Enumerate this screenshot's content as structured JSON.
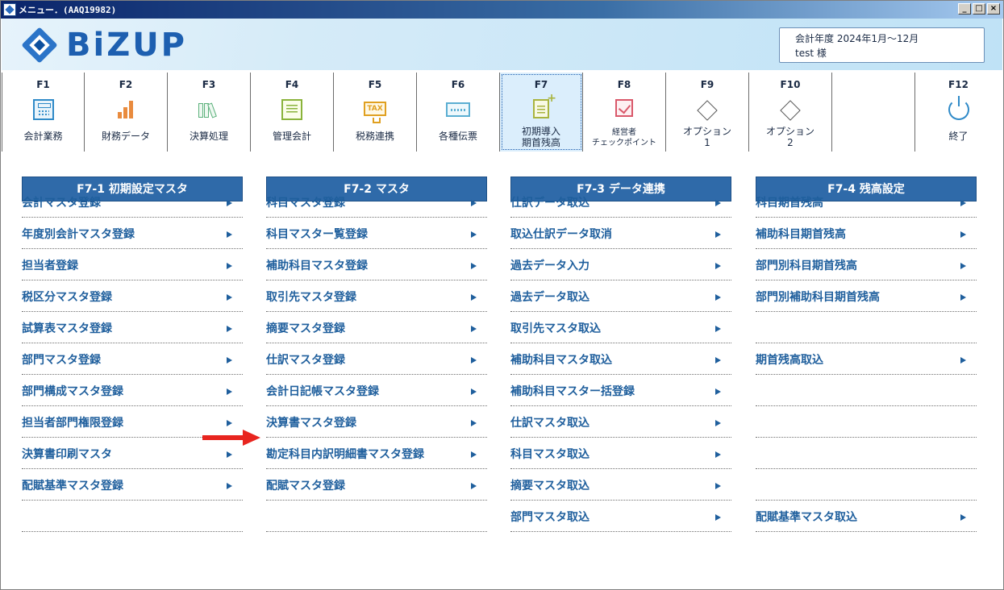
{
  "window": {
    "title": "メニュー．(AAQ19982)",
    "buttons": [
      "_",
      "□",
      "×"
    ]
  },
  "header": {
    "logo_text": "BiZUP",
    "fiscal_year": "会計年度 2024年1月～12月",
    "user": "test 様"
  },
  "fkeys": [
    {
      "key": "F1",
      "label": "会計業務",
      "icon": "calculator-icon"
    },
    {
      "key": "F2",
      "label": "財務データ",
      "icon": "bar-chart-icon"
    },
    {
      "key": "F3",
      "label": "決算処理",
      "icon": "binders-icon"
    },
    {
      "key": "F4",
      "label": "管理会計",
      "icon": "document-icon"
    },
    {
      "key": "F5",
      "label": "税務連携",
      "icon": "tax-monitor-icon"
    },
    {
      "key": "F6",
      "label": "各種伝票",
      "icon": "slip-icon"
    },
    {
      "key": "F7",
      "label1": "初期導入",
      "label2": "期首残高",
      "icon": "new-document-icon",
      "active": true
    },
    {
      "key": "F8",
      "label1": "経営者",
      "label2": "チェックポイント",
      "icon": "checkmark-icon"
    },
    {
      "key": "F9",
      "label1": "オプション",
      "label2": "1",
      "icon": "diamond-icon"
    },
    {
      "key": "F10",
      "label1": "オプション",
      "label2": "2",
      "icon": "diamond-icon"
    },
    {
      "key": "F12",
      "label": "終了",
      "icon": "power-icon"
    }
  ],
  "columns": [
    {
      "title": "F7-1 初期設定マスタ",
      "items": [
        "会計マスタ登録",
        "年度別会計マスタ登録",
        "担当者登録",
        "税区分マスタ登録",
        "試算表マスタ登録",
        "部門マスタ登録",
        "部門構成マスタ登録",
        "担当者部門権限登録",
        "決算書印刷マスタ",
        "配賦基準マスタ登録",
        ""
      ]
    },
    {
      "title": "F7-2 マスタ",
      "items": [
        "科目マスタ登録",
        "科目マスター覧登録",
        "補助科目マスタ登録",
        "取引先マスタ登録",
        "摘要マスタ登録",
        "仕訳マスタ登録",
        "会計日記帳マスタ登録",
        "決算書マスタ登録",
        "勘定科目内訳明細書マスタ登録",
        "配賦マスタ登録",
        ""
      ]
    },
    {
      "title": "F7-3 データ連携",
      "items": [
        "仕訳データ取込",
        "取込仕訳データ取消",
        "過去データ入力",
        "過去データ取込",
        "取引先マスタ取込",
        "補助科目マスタ取込",
        "補助科目マスター括登録",
        "仕訳マスタ取込",
        "科目マスタ取込",
        "摘要マスタ取込",
        "部門マスタ取込"
      ]
    },
    {
      "title": "F7-4 残高設定",
      "items": [
        "科目期首残高",
        "補助科目期首残高",
        "部門別科目期首残高",
        "部門別補助科目期首残高",
        "",
        "期首残高取込",
        "",
        "",
        "",
        "",
        "配賦基準マスタ取込"
      ]
    }
  ],
  "colors": {
    "accent": "#2f6aa9",
    "link": "#1f5f9d",
    "pointer": "#e8251f"
  }
}
